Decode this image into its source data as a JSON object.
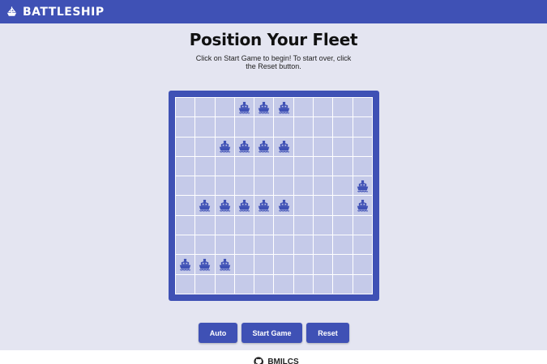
{
  "app": {
    "title": "BATTLESHIP",
    "logo_icon": "ship-wheel-icon"
  },
  "page": {
    "heading": "Position Your Fleet",
    "instructions": "Click on Start Game to begin! To start over, click the Reset button."
  },
  "board": {
    "rows": 10,
    "cols": 10,
    "ship_icon": "ship-icon",
    "ship_cells": [
      [
        0,
        3
      ],
      [
        0,
        4
      ],
      [
        0,
        5
      ],
      [
        2,
        2
      ],
      [
        2,
        3
      ],
      [
        2,
        4
      ],
      [
        2,
        5
      ],
      [
        4,
        9
      ],
      [
        5,
        9
      ],
      [
        5,
        1
      ],
      [
        5,
        2
      ],
      [
        5,
        3
      ],
      [
        5,
        4
      ],
      [
        5,
        5
      ],
      [
        8,
        0
      ],
      [
        8,
        1
      ],
      [
        8,
        2
      ]
    ]
  },
  "controls": {
    "auto_label": "Auto",
    "start_label": "Start Game",
    "reset_label": "Reset"
  },
  "footer": {
    "icon": "github-icon",
    "label": "BMILCS"
  },
  "colors": {
    "primary": "#3f51b5",
    "cell": "#c5cae9",
    "background": "#e4e5f1"
  }
}
